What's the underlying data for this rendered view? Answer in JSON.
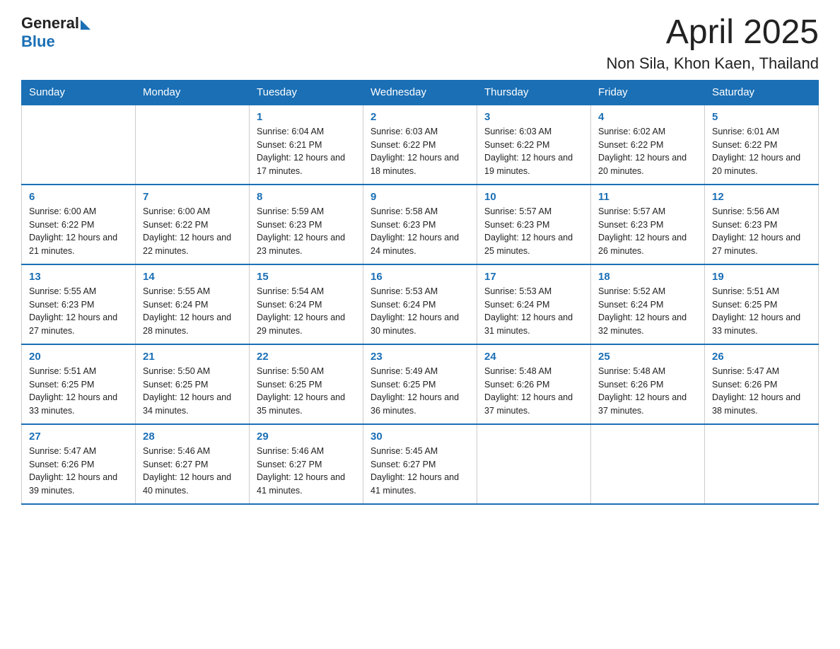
{
  "header": {
    "logo_general": "General",
    "logo_blue": "Blue",
    "month": "April 2025",
    "location": "Non Sila, Khon Kaen, Thailand"
  },
  "weekdays": [
    "Sunday",
    "Monday",
    "Tuesday",
    "Wednesday",
    "Thursday",
    "Friday",
    "Saturday"
  ],
  "weeks": [
    [
      {
        "day": "",
        "info": ""
      },
      {
        "day": "",
        "info": ""
      },
      {
        "day": "1",
        "info": "Sunrise: 6:04 AM\nSunset: 6:21 PM\nDaylight: 12 hours\nand 17 minutes."
      },
      {
        "day": "2",
        "info": "Sunrise: 6:03 AM\nSunset: 6:22 PM\nDaylight: 12 hours\nand 18 minutes."
      },
      {
        "day": "3",
        "info": "Sunrise: 6:03 AM\nSunset: 6:22 PM\nDaylight: 12 hours\nand 19 minutes."
      },
      {
        "day": "4",
        "info": "Sunrise: 6:02 AM\nSunset: 6:22 PM\nDaylight: 12 hours\nand 20 minutes."
      },
      {
        "day": "5",
        "info": "Sunrise: 6:01 AM\nSunset: 6:22 PM\nDaylight: 12 hours\nand 20 minutes."
      }
    ],
    [
      {
        "day": "6",
        "info": "Sunrise: 6:00 AM\nSunset: 6:22 PM\nDaylight: 12 hours\nand 21 minutes."
      },
      {
        "day": "7",
        "info": "Sunrise: 6:00 AM\nSunset: 6:22 PM\nDaylight: 12 hours\nand 22 minutes."
      },
      {
        "day": "8",
        "info": "Sunrise: 5:59 AM\nSunset: 6:23 PM\nDaylight: 12 hours\nand 23 minutes."
      },
      {
        "day": "9",
        "info": "Sunrise: 5:58 AM\nSunset: 6:23 PM\nDaylight: 12 hours\nand 24 minutes."
      },
      {
        "day": "10",
        "info": "Sunrise: 5:57 AM\nSunset: 6:23 PM\nDaylight: 12 hours\nand 25 minutes."
      },
      {
        "day": "11",
        "info": "Sunrise: 5:57 AM\nSunset: 6:23 PM\nDaylight: 12 hours\nand 26 minutes."
      },
      {
        "day": "12",
        "info": "Sunrise: 5:56 AM\nSunset: 6:23 PM\nDaylight: 12 hours\nand 27 minutes."
      }
    ],
    [
      {
        "day": "13",
        "info": "Sunrise: 5:55 AM\nSunset: 6:23 PM\nDaylight: 12 hours\nand 27 minutes."
      },
      {
        "day": "14",
        "info": "Sunrise: 5:55 AM\nSunset: 6:24 PM\nDaylight: 12 hours\nand 28 minutes."
      },
      {
        "day": "15",
        "info": "Sunrise: 5:54 AM\nSunset: 6:24 PM\nDaylight: 12 hours\nand 29 minutes."
      },
      {
        "day": "16",
        "info": "Sunrise: 5:53 AM\nSunset: 6:24 PM\nDaylight: 12 hours\nand 30 minutes."
      },
      {
        "day": "17",
        "info": "Sunrise: 5:53 AM\nSunset: 6:24 PM\nDaylight: 12 hours\nand 31 minutes."
      },
      {
        "day": "18",
        "info": "Sunrise: 5:52 AM\nSunset: 6:24 PM\nDaylight: 12 hours\nand 32 minutes."
      },
      {
        "day": "19",
        "info": "Sunrise: 5:51 AM\nSunset: 6:25 PM\nDaylight: 12 hours\nand 33 minutes."
      }
    ],
    [
      {
        "day": "20",
        "info": "Sunrise: 5:51 AM\nSunset: 6:25 PM\nDaylight: 12 hours\nand 33 minutes."
      },
      {
        "day": "21",
        "info": "Sunrise: 5:50 AM\nSunset: 6:25 PM\nDaylight: 12 hours\nand 34 minutes."
      },
      {
        "day": "22",
        "info": "Sunrise: 5:50 AM\nSunset: 6:25 PM\nDaylight: 12 hours\nand 35 minutes."
      },
      {
        "day": "23",
        "info": "Sunrise: 5:49 AM\nSunset: 6:25 PM\nDaylight: 12 hours\nand 36 minutes."
      },
      {
        "day": "24",
        "info": "Sunrise: 5:48 AM\nSunset: 6:26 PM\nDaylight: 12 hours\nand 37 minutes."
      },
      {
        "day": "25",
        "info": "Sunrise: 5:48 AM\nSunset: 6:26 PM\nDaylight: 12 hours\nand 37 minutes."
      },
      {
        "day": "26",
        "info": "Sunrise: 5:47 AM\nSunset: 6:26 PM\nDaylight: 12 hours\nand 38 minutes."
      }
    ],
    [
      {
        "day": "27",
        "info": "Sunrise: 5:47 AM\nSunset: 6:26 PM\nDaylight: 12 hours\nand 39 minutes."
      },
      {
        "day": "28",
        "info": "Sunrise: 5:46 AM\nSunset: 6:27 PM\nDaylight: 12 hours\nand 40 minutes."
      },
      {
        "day": "29",
        "info": "Sunrise: 5:46 AM\nSunset: 6:27 PM\nDaylight: 12 hours\nand 41 minutes."
      },
      {
        "day": "30",
        "info": "Sunrise: 5:45 AM\nSunset: 6:27 PM\nDaylight: 12 hours\nand 41 minutes."
      },
      {
        "day": "",
        "info": ""
      },
      {
        "day": "",
        "info": ""
      },
      {
        "day": "",
        "info": ""
      }
    ]
  ]
}
